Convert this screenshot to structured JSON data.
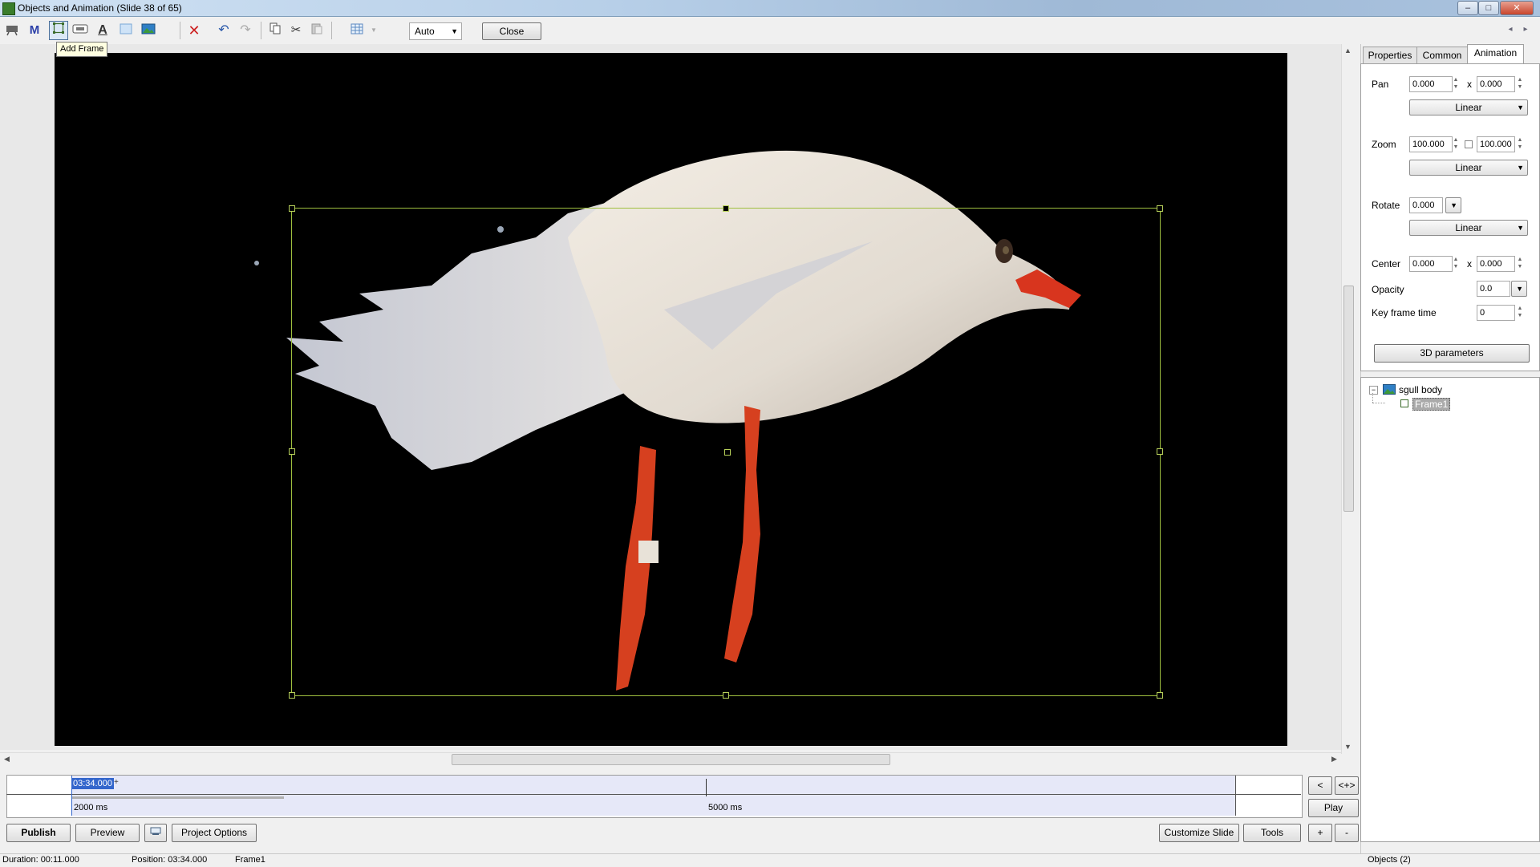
{
  "window": {
    "title": "Objects and Animation  (Slide 38 of 65)",
    "min": "–",
    "max": "□",
    "close": "✕"
  },
  "toolbar": {
    "mask_label": "M",
    "text_label": "A",
    "mode_value": "Auto",
    "close_label": "Close",
    "tooltip": "Add Frame",
    "nav_prev": "◂",
    "nav_next": "▸"
  },
  "timeline": {
    "current_time": "03:34.000",
    "plus": "+",
    "tick_left": "2000 ms",
    "tick_mid": "5000 ms",
    "btn_prev": "<",
    "btn_fit": "<+>",
    "btn_play": "Play"
  },
  "bottom": {
    "publish": "Publish",
    "preview": "Preview",
    "project_options": "Project Options",
    "customize_slide": "Customize Slide",
    "tools": "Tools",
    "plus": "+",
    "minus": "-"
  },
  "panel": {
    "tabs": [
      "Properties",
      "Common",
      "Animation"
    ],
    "pan_label": "Pan",
    "pan_x": "0.000",
    "pan_y": "0.000",
    "x_sep": "x",
    "pan_interp": "Linear",
    "zoom_label": "Zoom",
    "zoom_x": "100.000",
    "zoom_y": "100.000",
    "zoom_interp": "Linear",
    "rotate_label": "Rotate",
    "rotate": "0.000",
    "rotate_interp": "Linear",
    "center_label": "Center",
    "center_x": "0.000",
    "center_y": "0.000",
    "opacity_label": "Opacity",
    "opacity": "0.0",
    "kft_label": "Key frame time",
    "kft": "0",
    "params_3d": "3D parameters"
  },
  "tree": {
    "expander": "−",
    "root": "sgull body",
    "child": "Frame1"
  },
  "status": {
    "duration": "Duration:  00:11.000",
    "position": "Position:  03:34.000",
    "object": "Frame1",
    "objects": "Objects (2)"
  },
  "colors": {
    "frame_outline": "#9fbf3f",
    "selection": "#3366cc",
    "canvas": "#000000"
  }
}
